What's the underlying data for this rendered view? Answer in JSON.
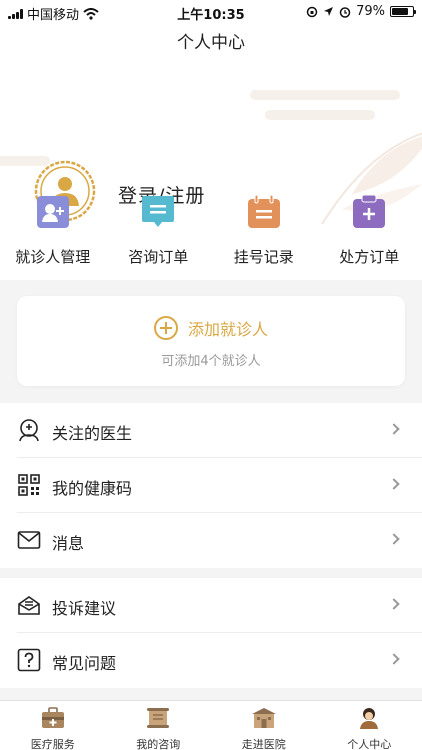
{
  "status_bar": {
    "carrier": "中国移动",
    "time": "上午10:35",
    "battery": "79%",
    "battery_level": 0.79
  },
  "nav": {
    "title": "个人中心"
  },
  "profile": {
    "login_label": "登录/注册"
  },
  "quick_actions": [
    {
      "label": "就诊人管理",
      "icon": "patient-management-icon",
      "color": "#8a8ed8"
    },
    {
      "label": "咨询订单",
      "icon": "consultation-order-icon",
      "color": "#55b9cf"
    },
    {
      "label": "挂号记录",
      "icon": "registration-record-icon",
      "color": "#e2915b"
    },
    {
      "label": "处方订单",
      "icon": "prescription-order-icon",
      "color": "#8d6cbf"
    }
  ],
  "add_patient": {
    "title": "添加就诊人",
    "subtitle": "可添加4个就诊人"
  },
  "menu_group1": [
    {
      "label": "关注的医生",
      "icon": "doctor-icon"
    },
    {
      "label": "我的健康码",
      "icon": "qr-code-icon"
    },
    {
      "label": "消息",
      "icon": "mail-icon"
    }
  ],
  "menu_group2": [
    {
      "label": "投诉建议",
      "icon": "complaint-icon"
    },
    {
      "label": "常见问题",
      "icon": "question-icon"
    }
  ],
  "tabs": [
    {
      "label": "医疗服务",
      "icon": "medical-kit-icon"
    },
    {
      "label": "我的咨询",
      "icon": "consult-scroll-icon"
    },
    {
      "label": "走进医院",
      "icon": "hospital-icon"
    },
    {
      "label": "个人中心",
      "icon": "profile-icon"
    }
  ],
  "colors": {
    "accent": "#d9a845",
    "text": "#222222",
    "muted": "#999999"
  }
}
